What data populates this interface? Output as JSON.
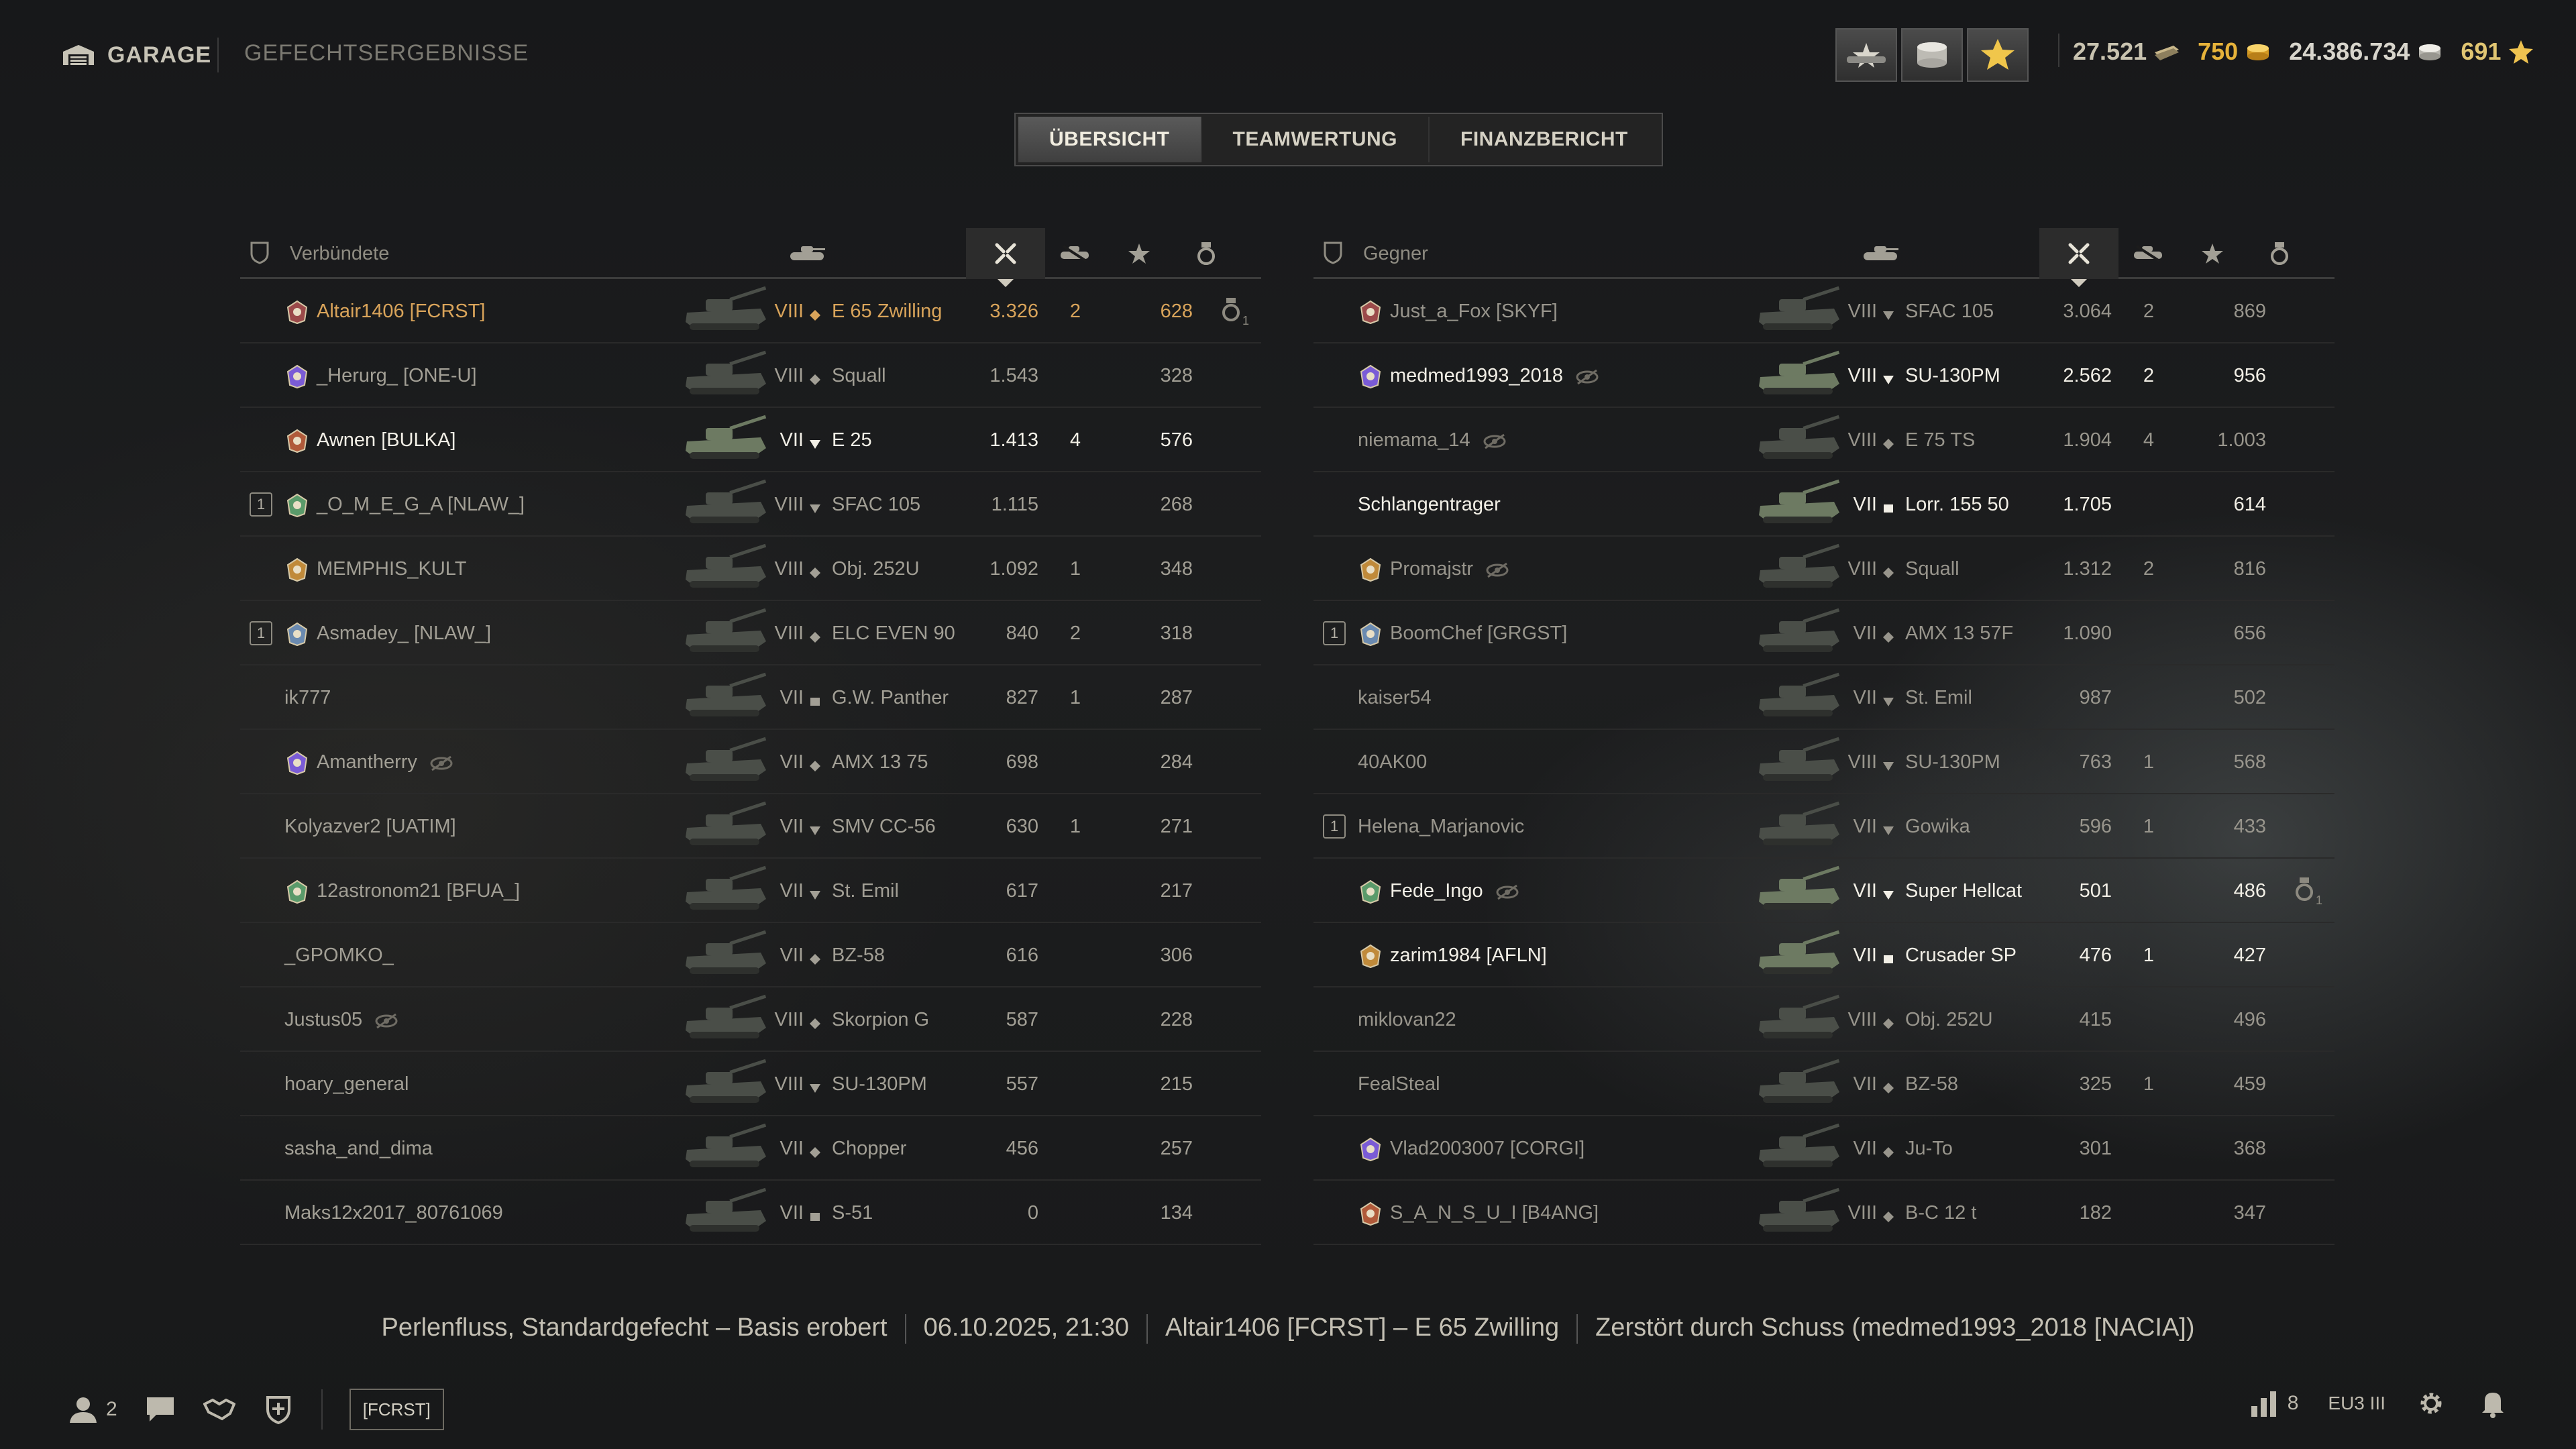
{
  "header": {
    "garage_label": "GARAGE",
    "page_title": "GEFECHTSERGEBNISSE",
    "reserves": [
      "tank-reserve-icon",
      "credits-reserve-icon",
      "xp-reserve-icon"
    ],
    "currencies": {
      "bonds": "27.521",
      "gold": "750",
      "credits": "24.386.734",
      "free_xp": "691"
    }
  },
  "tabs": [
    {
      "label": "ÜBERSICHT",
      "active": true
    },
    {
      "label": "TEAMWERTUNG",
      "active": false
    },
    {
      "label": "FINANZBERICHT",
      "active": false
    }
  ],
  "allies": {
    "title": "Verbündete",
    "rows": [
      {
        "platoon": "",
        "clan_icon": "clan-emblem-icon",
        "name": "Altair1406 [FCRST]",
        "hidden": false,
        "tier": "VIII",
        "cls": "mt",
        "tank": "E 65 Zwilling",
        "dmg": "3.326",
        "kills": "2",
        "xp": "628",
        "medal": true,
        "medal_count": "1",
        "style": "me"
      },
      {
        "platoon": "",
        "clan_icon": "clan-emblem-icon",
        "name": "_Herurg_ [ONE-U]",
        "hidden": false,
        "tier": "VIII",
        "cls": "mt",
        "tank": "Squall",
        "dmg": "1.543",
        "kills": "",
        "xp": "328",
        "medal": false,
        "style": "dim"
      },
      {
        "platoon": "",
        "clan_icon": "clan-emblem-icon",
        "name": "Awnen [BULKA]",
        "hidden": false,
        "tier": "VII",
        "cls": "td",
        "tank": "E 25",
        "dmg": "1.413",
        "kills": "4",
        "xp": "576",
        "medal": false,
        "style": "plat"
      },
      {
        "platoon": "1",
        "clan_icon": "clan-emblem-icon",
        "name": "_O_M_E_G_A [NLAW_]",
        "hidden": false,
        "tier": "VIII",
        "cls": "td",
        "tank": "SFAC 105",
        "dmg": "1.115",
        "kills": "",
        "xp": "268",
        "medal": false,
        "style": "dim"
      },
      {
        "platoon": "",
        "clan_icon": "clan-emblem-icon",
        "name": "MEMPHIS_KULT",
        "hidden": false,
        "tier": "VIII",
        "cls": "mt",
        "tank": "Obj. 252U",
        "dmg": "1.092",
        "kills": "1",
        "xp": "348",
        "medal": false,
        "style": "dim"
      },
      {
        "platoon": "1",
        "clan_icon": "clan-emblem-icon",
        "name": "Asmadey_ [NLAW_]",
        "hidden": false,
        "tier": "VIII",
        "cls": "mt",
        "tank": "ELC EVEN 90",
        "dmg": "840",
        "kills": "2",
        "xp": "318",
        "medal": false,
        "style": "dim"
      },
      {
        "platoon": "",
        "clan_icon": "",
        "name": "ik777",
        "hidden": false,
        "tier": "VII",
        "cls": "spg",
        "tank": "G.W. Panther",
        "dmg": "827",
        "kills": "1",
        "xp": "287",
        "medal": false,
        "style": "dim"
      },
      {
        "platoon": "",
        "clan_icon": "clan-emblem-icon",
        "name": "Amantherry",
        "hidden": true,
        "tier": "VII",
        "cls": "mt",
        "tank": "AMX 13 75",
        "dmg": "698",
        "kills": "",
        "xp": "284",
        "medal": false,
        "style": "dim"
      },
      {
        "platoon": "",
        "clan_icon": "",
        "name": "Kolyazver2 [UATIM]",
        "hidden": false,
        "tier": "VII",
        "cls": "td",
        "tank": "SMV CC-56",
        "dmg": "630",
        "kills": "1",
        "xp": "271",
        "medal": false,
        "style": "dim"
      },
      {
        "platoon": "",
        "clan_icon": "clan-emblem-icon",
        "name": "12astronom21 [BFUA_]",
        "hidden": false,
        "tier": "VII",
        "cls": "td",
        "tank": "St. Emil",
        "dmg": "617",
        "kills": "",
        "xp": "217",
        "medal": false,
        "style": "dim"
      },
      {
        "platoon": "",
        "clan_icon": "",
        "name": "_GPOMKO_",
        "hidden": false,
        "tier": "VII",
        "cls": "mt",
        "tank": "BZ-58",
        "dmg": "616",
        "kills": "",
        "xp": "306",
        "medal": false,
        "style": "dim"
      },
      {
        "platoon": "",
        "clan_icon": "",
        "name": "Justus05",
        "hidden": true,
        "tier": "VIII",
        "cls": "mt",
        "tank": "Skorpion G",
        "dmg": "587",
        "kills": "",
        "xp": "228",
        "medal": false,
        "style": "dim"
      },
      {
        "platoon": "",
        "clan_icon": "",
        "name": "hoary_general",
        "hidden": false,
        "tier": "VIII",
        "cls": "td",
        "tank": "SU-130PM",
        "dmg": "557",
        "kills": "",
        "xp": "215",
        "medal": false,
        "style": "dim"
      },
      {
        "platoon": "",
        "clan_icon": "",
        "name": "sasha_and_dima",
        "hidden": false,
        "tier": "VII",
        "cls": "mt",
        "tank": "Chopper",
        "dmg": "456",
        "kills": "",
        "xp": "257",
        "medal": false,
        "style": "dim"
      },
      {
        "platoon": "",
        "clan_icon": "",
        "name": "Maks12x2017_80761069",
        "hidden": false,
        "tier": "VII",
        "cls": "spg",
        "tank": "S-51",
        "dmg": "0",
        "kills": "",
        "xp": "134",
        "medal": false,
        "style": "dim"
      }
    ]
  },
  "enemies": {
    "title": "Gegner",
    "rows": [
      {
        "platoon": "",
        "clan_icon": "clan-emblem-icon",
        "name": "Just_a_Fox [SKYF]",
        "hidden": false,
        "tier": "VIII",
        "cls": "td",
        "tank": "SFAC 105",
        "dmg": "3.064",
        "kills": "2",
        "xp": "869",
        "medal": false,
        "style": "dim"
      },
      {
        "platoon": "",
        "clan_icon": "clan-emblem-icon",
        "name": "medmed1993_2018",
        "hidden": true,
        "tier": "VIII",
        "cls": "td",
        "tank": "SU-130PM",
        "dmg": "2.562",
        "kills": "2",
        "xp": "956",
        "medal": false,
        "style": "plat"
      },
      {
        "platoon": "",
        "clan_icon": "",
        "name": "niemama_14",
        "hidden": true,
        "tier": "VIII",
        "cls": "mt",
        "tank": "E 75 TS",
        "dmg": "1.904",
        "kills": "4",
        "xp": "1.003",
        "medal": false,
        "style": "dim"
      },
      {
        "platoon": "",
        "clan_icon": "",
        "name": "Schlangentrager",
        "hidden": false,
        "tier": "VII",
        "cls": "spg",
        "tank": "Lorr. 155 50",
        "dmg": "1.705",
        "kills": "",
        "xp": "614",
        "medal": false,
        "style": "plat"
      },
      {
        "platoon": "",
        "clan_icon": "clan-emblem-icon",
        "name": "Promajstr",
        "hidden": true,
        "tier": "VIII",
        "cls": "mt",
        "tank": "Squall",
        "dmg": "1.312",
        "kills": "2",
        "xp": "816",
        "medal": false,
        "style": "dim"
      },
      {
        "platoon": "1",
        "clan_icon": "clan-emblem-icon",
        "name": "BoomChef [GRGST]",
        "hidden": false,
        "tier": "VII",
        "cls": "mt",
        "tank": "AMX 13 57F",
        "dmg": "1.090",
        "kills": "",
        "xp": "656",
        "medal": false,
        "style": "dim"
      },
      {
        "platoon": "",
        "clan_icon": "",
        "name": "kaiser54",
        "hidden": false,
        "tier": "VII",
        "cls": "td",
        "tank": "St. Emil",
        "dmg": "987",
        "kills": "",
        "xp": "502",
        "medal": false,
        "style": "dim"
      },
      {
        "platoon": "",
        "clan_icon": "",
        "name": "40AK00",
        "hidden": false,
        "tier": "VIII",
        "cls": "td",
        "tank": "SU-130PM",
        "dmg": "763",
        "kills": "1",
        "xp": "568",
        "medal": false,
        "style": "dim"
      },
      {
        "platoon": "1",
        "clan_icon": "",
        "name": "Helena_Marjanovic",
        "hidden": false,
        "tier": "VII",
        "cls": "td",
        "tank": "Gowika",
        "dmg": "596",
        "kills": "1",
        "xp": "433",
        "medal": false,
        "style": "dim"
      },
      {
        "platoon": "",
        "clan_icon": "clan-emblem-icon",
        "name": "Fede_Ingo",
        "hidden": true,
        "tier": "VII",
        "cls": "td",
        "tank": "Super Hellcat",
        "dmg": "501",
        "kills": "",
        "xp": "486",
        "medal": true,
        "medal_count": "1",
        "style": "plat"
      },
      {
        "platoon": "",
        "clan_icon": "clan-emblem-icon",
        "name": "zarim1984 [AFLN]",
        "hidden": false,
        "tier": "VII",
        "cls": "spg",
        "tank": "Crusader SP",
        "dmg": "476",
        "kills": "1",
        "xp": "427",
        "medal": false,
        "style": "plat"
      },
      {
        "platoon": "",
        "clan_icon": "",
        "name": "miklovan22",
        "hidden": false,
        "tier": "VIII",
        "cls": "mt",
        "tank": "Obj. 252U",
        "dmg": "415",
        "kills": "",
        "xp": "496",
        "medal": false,
        "style": "dim"
      },
      {
        "platoon": "",
        "clan_icon": "",
        "name": "FealSteal",
        "hidden": false,
        "tier": "VII",
        "cls": "mt",
        "tank": "BZ-58",
        "dmg": "325",
        "kills": "1",
        "xp": "459",
        "medal": false,
        "style": "dim"
      },
      {
        "platoon": "",
        "clan_icon": "clan-emblem-icon",
        "name": "Vlad2003007 [CORGI]",
        "hidden": false,
        "tier": "VII",
        "cls": "mt",
        "tank": "Ju-To",
        "dmg": "301",
        "kills": "",
        "xp": "368",
        "medal": false,
        "style": "dim"
      },
      {
        "platoon": "",
        "clan_icon": "clan-emblem-icon",
        "name": "S_A_N_S_U_I [B4ANG]",
        "hidden": false,
        "tier": "VIII",
        "cls": "mt",
        "tank": "B-C 12 t",
        "dmg": "182",
        "kills": "",
        "xp": "347",
        "medal": false,
        "style": "dim"
      }
    ]
  },
  "battle_info": {
    "map_mode": "Perlenfluss, Standardgefecht – Basis erobert",
    "datetime": "06.10.2025, 21:30",
    "player_vehicle": "Altair1406 [FCRST] – E 65 Zwilling",
    "death": "Zerstört durch Schuss (medmed1993_2018 [NACIA])"
  },
  "bottom": {
    "friends_count": "2",
    "clan_tag": "[FCRST]",
    "players_online": "8",
    "server": "EU3 III"
  },
  "colors": {
    "me": "#d9a45a",
    "platoon_white": "#f2efe6",
    "gold": "#e6b23a"
  }
}
